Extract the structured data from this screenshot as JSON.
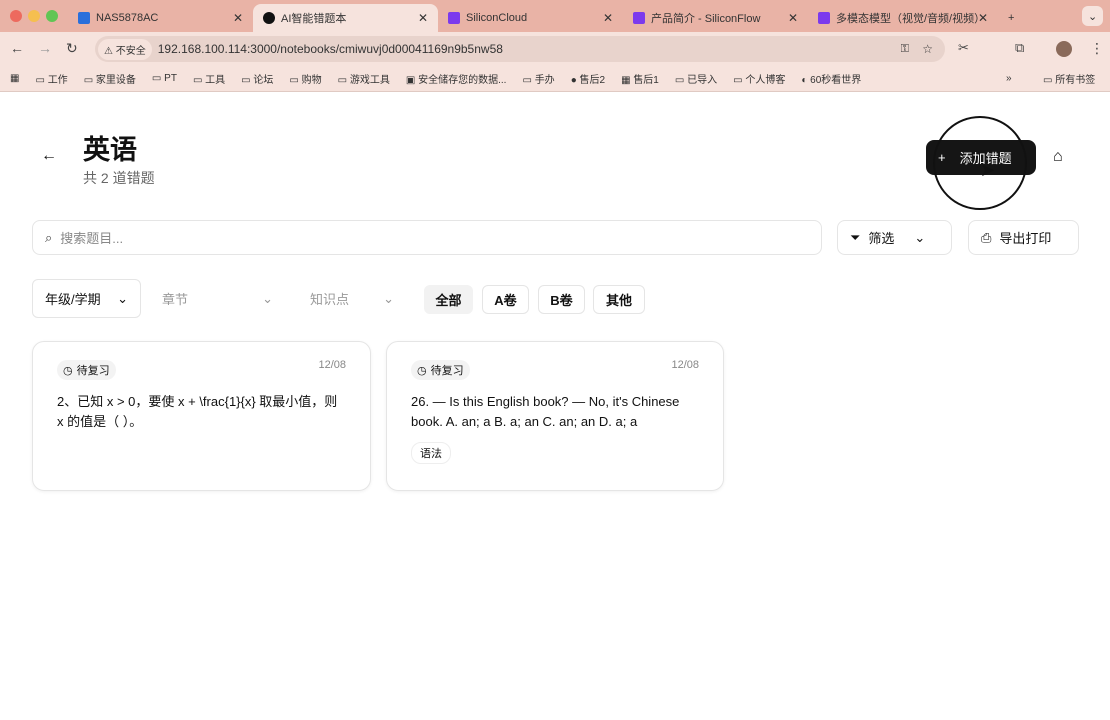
{
  "browser": {
    "tabs": [
      {
        "title": "NAS5878AC"
      },
      {
        "title": "AI智能错题本"
      },
      {
        "title": "SiliconCloud"
      },
      {
        "title": "产品简介 - SiliconFlow"
      },
      {
        "title": "多模态模型（视觉/音频/视频）"
      }
    ],
    "security_label": "不安全",
    "url": "192.168.100.114:3000/notebooks/cmiwuvj0d00041169n9b5nw58",
    "bookmarks": [
      "工作",
      "家里设备",
      "PT",
      "工具",
      "论坛",
      "购物",
      "游戏工具",
      "安全储存您的数据...",
      "手办",
      "售后2",
      "售后1",
      "已导入",
      "个人博客",
      "60秒看世界"
    ],
    "all_bookmarks": "所有书签"
  },
  "header": {
    "title": "英语",
    "subtitle": "共 2 道错题",
    "add_label": "添加错题"
  },
  "search": {
    "placeholder": "搜索题目..."
  },
  "filter_label": "筛选",
  "export_label": "导出打印",
  "selects": {
    "grade": "年级/学期",
    "chapter": "章节",
    "knowledge": "知识点"
  },
  "chips": [
    "全部",
    "A卷",
    "B卷",
    "其他"
  ],
  "cards": [
    {
      "status": "待复习",
      "date": "12/08",
      "question": "2、已知 x > 0，要使 x + \\frac{1}{x} 取最小值，则 x 的值是（ ）。"
    },
    {
      "status": "待复习",
      "date": "12/08",
      "question": "26. — Is this English book? — No, it's Chinese book. A. an; a B. a; an C. an; an D. a; a",
      "tag": "语法"
    }
  ]
}
